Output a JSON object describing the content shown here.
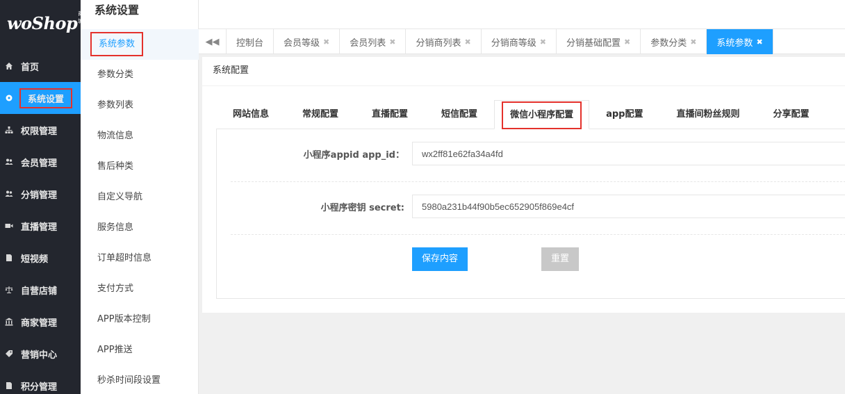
{
  "logo": {
    "text": "woShop",
    "badge": "商城"
  },
  "leftnav": {
    "items": [
      {
        "label": "首页",
        "icon": "home-icon"
      },
      {
        "label": "系统设置",
        "icon": "gear-icon"
      },
      {
        "label": "权限管理",
        "icon": "sitemap-icon"
      },
      {
        "label": "会员管理",
        "icon": "users-icon"
      },
      {
        "label": "分销管理",
        "icon": "users-icon"
      },
      {
        "label": "直播管理",
        "icon": "video-icon"
      },
      {
        "label": "短视频",
        "icon": "file-icon"
      },
      {
        "label": "自营店铺",
        "icon": "balance-icon"
      },
      {
        "label": "商家管理",
        "icon": "bank-icon"
      },
      {
        "label": "营销中心",
        "icon": "tag-icon"
      },
      {
        "label": "积分管理",
        "icon": "file-icon"
      }
    ]
  },
  "subnav": {
    "title": "系统设置",
    "items": [
      "系统参数",
      "参数分类",
      "参数列表",
      "物流信息",
      "售后种类",
      "自定义导航",
      "服务信息",
      "订单超时信息",
      "支付方式",
      "APP版本控制",
      "APP推送",
      "秒杀时间段设置"
    ]
  },
  "pagetabs": {
    "items": [
      "控制台",
      "会员等级",
      "会员列表",
      "分销商列表",
      "分销商等级",
      "分销基础配置",
      "参数分类",
      "系统参数"
    ],
    "close_glyph": "✖"
  },
  "panel": {
    "title": "系统配置",
    "config_tabs": [
      "网站信息",
      "常规配置",
      "直播配置",
      "短信配置",
      "微信小程序配置",
      "app配置",
      "直播间粉丝规则",
      "分享配置"
    ],
    "fields": [
      {
        "label": "小程序appid app_id：",
        "value": "wx2ff81e62fa34a4fd"
      },
      {
        "label": "小程序密钥 secret:",
        "value": "5980a231b44f90b5ec652905f869e4cf"
      }
    ],
    "save_label": "保存内容",
    "reset_label": "重置"
  },
  "colors": {
    "accent": "#1e9fff",
    "nav_bg": "#23262e",
    "highlight": "#e4312b"
  }
}
